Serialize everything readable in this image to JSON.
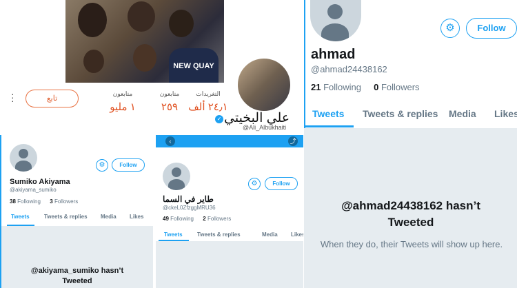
{
  "panel1": {
    "follow_label": "تابع",
    "stats": [
      {
        "label": "التغريدات",
        "value": "٢٤٫١ ألف"
      },
      {
        "label": "متابعون",
        "value": "٢٥٩"
      },
      {
        "label": "متابعون",
        "value": "١ مليو"
      }
    ],
    "name": "علي البخيتي",
    "handle": "@Ali_Albukhaiti",
    "shirt_text": "NEW QUAY"
  },
  "panel2": {
    "name": "ahmad",
    "handle": "@ahmad24438162",
    "following_count": "21",
    "following_label": "Following",
    "followers_count": "0",
    "followers_label": "Followers",
    "follow_label": "Follow",
    "tabs": [
      "Tweets",
      "Tweets & replies",
      "Media",
      "Likes"
    ],
    "empty_title": "@ahmad24438162 hasn’t Tweeted",
    "empty_sub": "When they do, their Tweets will show up here."
  },
  "panel3": {
    "name": "Sumiko Akiyama",
    "handle": "@akiyama_sumiko",
    "following_count": "38",
    "following_label": "Following",
    "followers_count": "3",
    "followers_label": "Followers",
    "follow_label": "Follow",
    "tabs": [
      "Tweets",
      "Tweets & replies",
      "Media",
      "Likes"
    ],
    "empty_title": "@akiyama_sumiko hasn’t Tweeted"
  },
  "panel4": {
    "name": "طاير في السما",
    "handle": "@ckeL0ZfzggMRU36",
    "following_count": "49",
    "following_label": "Following",
    "followers_count": "2",
    "followers_label": "Followers",
    "follow_label": "Follow",
    "tabs": [
      "Tweets",
      "Tweets & replies",
      "Media",
      "Likes"
    ]
  },
  "colors": {
    "accent": "#1da1f2",
    "orange": "#e06030",
    "bg": "#e6ecf0"
  },
  "icons": [
    "gear-icon",
    "back-arrow-icon",
    "share-icon",
    "verified-icon",
    "more-icon"
  ]
}
